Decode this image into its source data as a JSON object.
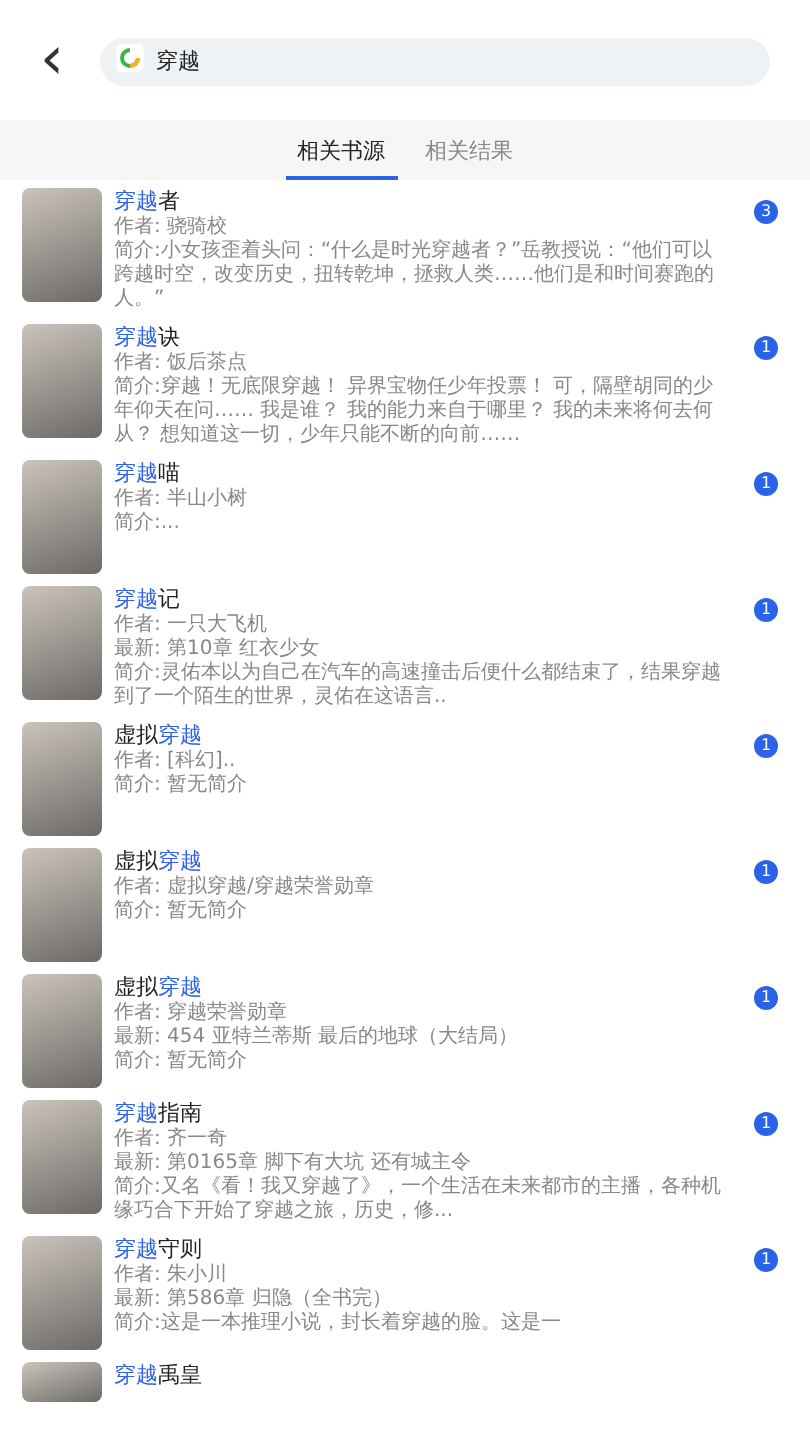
{
  "header": {
    "back": "‹",
    "search_value": "穿越"
  },
  "tabs": [
    {
      "label": "相关书源",
      "selected": true
    },
    {
      "label": "相关结果",
      "selected": false
    }
  ],
  "books": [
    {
      "title": [
        {
          "text": "穿越",
          "highlight": true
        },
        {
          "text": "者",
          "highlight": false
        }
      ],
      "lines": [
        "作者: 骁骑校",
        "简介:小女孩歪着头问：“什么是时光穿越者？”岳教授说：“他们可以跨越时空，改变历史，扭转乾坤，拯救人类……他们是和时间赛跑的人。”"
      ],
      "count": "3"
    },
    {
      "title": [
        {
          "text": "穿越",
          "highlight": true
        },
        {
          "text": "诀",
          "highlight": false
        }
      ],
      "lines": [
        "作者: 饭后茶点",
        "简介:穿越！无底限穿越！ 异界宝物任少年投票！ 可，隔壁胡同的少年仰天在问…… 我是谁？ 我的能力来自于哪里？ 我的未来将何去何从？ 想知道这一切，少年只能不断的向前……"
      ],
      "count": "1"
    },
    {
      "title": [
        {
          "text": "穿越",
          "highlight": true
        },
        {
          "text": "喵",
          "highlight": false
        }
      ],
      "lines": [
        "作者: 半山小树",
        "简介:..."
      ],
      "count": "1"
    },
    {
      "title": [
        {
          "text": "穿越",
          "highlight": true
        },
        {
          "text": "记",
          "highlight": false
        }
      ],
      "lines": [
        "作者: 一只大飞机",
        "最新: 第10章 红衣少女",
        "简介:灵佑本以为自己在汽车的高速撞击后便什么都结束了，结果穿越到了一个陌生的世界，灵佑在这语言.."
      ],
      "count": "1"
    },
    {
      "title": [
        {
          "text": "虚拟",
          "highlight": false
        },
        {
          "text": "穿越",
          "highlight": true
        }
      ],
      "lines": [
        "作者: [科幻]..",
        "简介: 暂无简介"
      ],
      "count": "1"
    },
    {
      "title": [
        {
          "text": "虚拟",
          "highlight": false
        },
        {
          "text": "穿越",
          "highlight": true
        }
      ],
      "lines": [
        "作者: 虚拟穿越/穿越荣誉勋章",
        "简介: 暂无简介"
      ],
      "count": "1"
    },
    {
      "title": [
        {
          "text": "虚拟",
          "highlight": false
        },
        {
          "text": "穿越",
          "highlight": true
        }
      ],
      "lines": [
        "作者: 穿越荣誉勋章",
        "最新: 454 亚特兰蒂斯 最后的地球（大结局）",
        "简介: 暂无简介"
      ],
      "count": "1"
    },
    {
      "title": [
        {
          "text": "穿越",
          "highlight": true
        },
        {
          "text": "指南",
          "highlight": false
        }
      ],
      "lines": [
        "作者: 齐一奇",
        "最新: 第0165章 脚下有大坑 还有城主令",
        "简介:又名《看！我又穿越了》，一个生活在未来都市的主播，各种机缘巧合下开始了穿越之旅，历史，修..."
      ],
      "count": "1"
    },
    {
      "title": [
        {
          "text": "穿越",
          "highlight": true
        },
        {
          "text": "守则",
          "highlight": false
        }
      ],
      "lines": [
        "作者: 朱小川",
        "最新: 第586章 归隐（全书完）",
        "简介:这是一本推理小说，封长着穿越的脸。这是一"
      ],
      "count": "1"
    },
    {
      "title": [
        {
          "text": "穿越",
          "highlight": true
        },
        {
          "text": "禹皇",
          "highlight": false
        }
      ]
    }
  ]
}
